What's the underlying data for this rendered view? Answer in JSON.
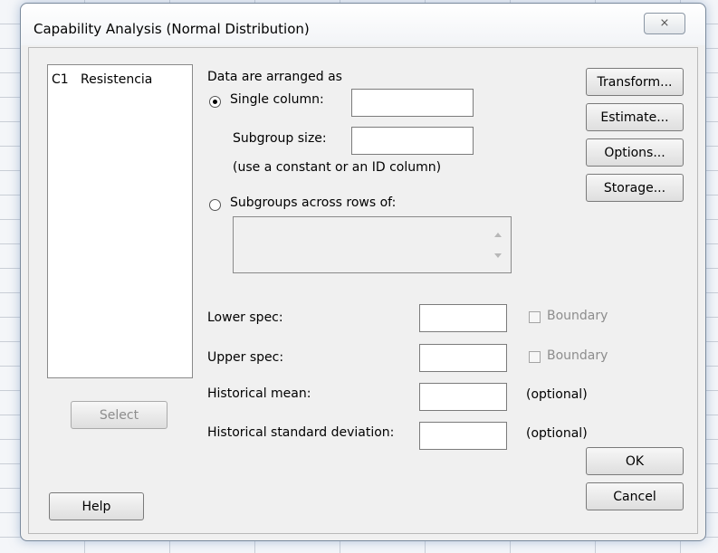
{
  "dialog": {
    "title": "Capability Analysis (Normal Distribution)",
    "close_glyph": "⨯"
  },
  "variables_list": {
    "items": [
      "C1   Resistencia"
    ]
  },
  "data_arranged": {
    "label": "Data are arranged as",
    "single_column_label": "Single column:",
    "single_column_value": "",
    "single_column_selected": true,
    "subgroup_size_label": "Subgroup size:",
    "subgroup_size_value": "",
    "subgroup_hint": "(use a constant or an ID column)",
    "subgroups_across_label": "Subgroups across rows of:",
    "subgroups_across_value": ""
  },
  "specs": {
    "lower_label": "Lower spec:",
    "lower_value": "",
    "lower_boundary_label": "Boundary",
    "upper_label": "Upper spec:",
    "upper_value": "",
    "upper_boundary_label": "Boundary",
    "hist_mean_label": "Historical mean:",
    "hist_mean_value": "",
    "hist_mean_note": "(optional)",
    "hist_sd_label": "Historical standard deviation:",
    "hist_sd_value": "",
    "hist_sd_note": "(optional)"
  },
  "buttons": {
    "transform": "Transform...",
    "estimate": "Estimate...",
    "options": "Options...",
    "storage": "Storage...",
    "select": "Select",
    "help": "Help",
    "ok": "OK",
    "cancel": "Cancel"
  }
}
